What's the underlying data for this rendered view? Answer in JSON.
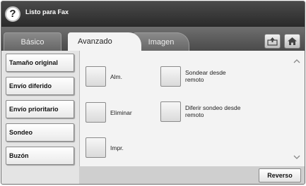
{
  "status": {
    "help_icon": "?",
    "text": "Listo para Fax"
  },
  "tabs": [
    {
      "label": "Básico",
      "active": false
    },
    {
      "label": "Avanzado",
      "active": true
    },
    {
      "label": "Imagen",
      "active": false
    }
  ],
  "toolbar_icons": [
    "upload-icon",
    "home-icon"
  ],
  "sidebar": {
    "items": [
      {
        "label": "Tamaño original"
      },
      {
        "label": "Envío diferido"
      },
      {
        "label": "Envío prioritario"
      },
      {
        "label": "Sondeo"
      },
      {
        "label": "Buzón"
      }
    ]
  },
  "options": {
    "alm": "Alm.",
    "eliminar": "Eliminar",
    "impr": "Impr.",
    "sondear": "Sondear desde remoto",
    "diferir": "Diferir sondeo desde remoto"
  },
  "scroll": {
    "up": "^",
    "down": "v"
  },
  "bottom": {
    "reverso_label": "Reverso"
  },
  "colors": {
    "titlebar": "#2a2a2a",
    "panel": "#f3f3f3",
    "background": "#cfcfcf"
  }
}
